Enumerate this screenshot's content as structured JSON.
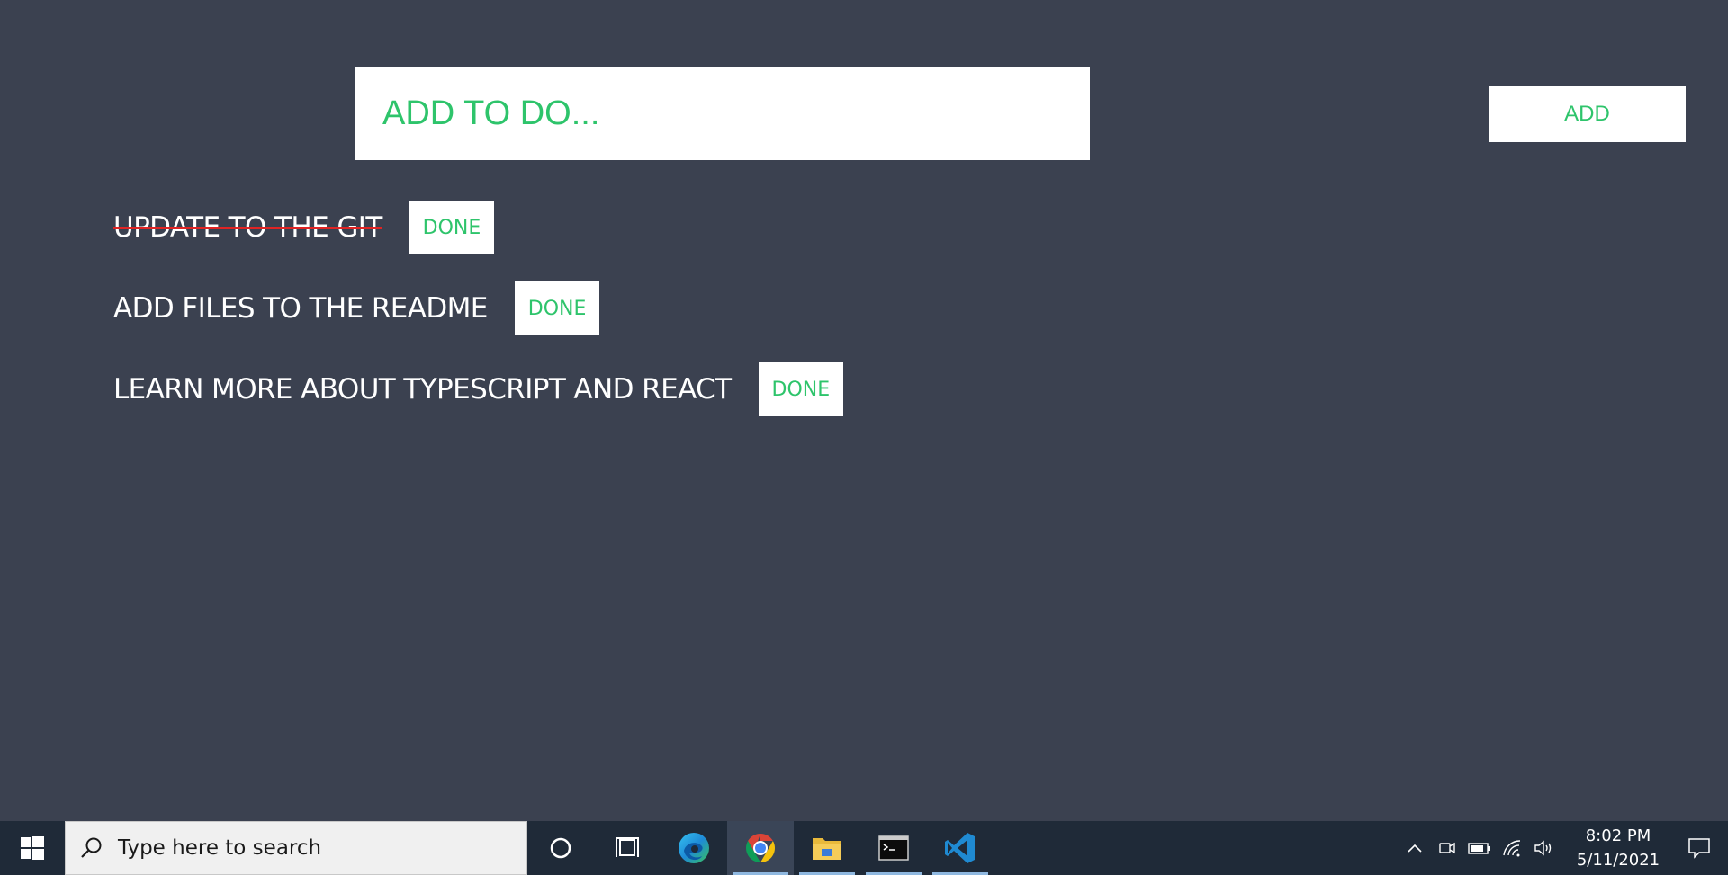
{
  "app": {
    "input": {
      "placeholder": "ADD TO DO...",
      "value": ""
    },
    "add_label": "ADD",
    "todos": [
      {
        "text": "UPDATE TO THE GIT",
        "completed": true,
        "button": "DONE"
      },
      {
        "text": "ADD FILES TO THE README",
        "completed": false,
        "button": "DONE"
      },
      {
        "text": "LEARN MORE ABOUT TYPESCRIPT AND REACT",
        "completed": false,
        "button": "DONE"
      }
    ],
    "colors": {
      "background": "#3b4150",
      "accent": "#2ec46b",
      "strike": "#e02424"
    }
  },
  "taskbar": {
    "search_placeholder": "Type here to search",
    "pinned": [
      {
        "icon": "cortana-icon"
      },
      {
        "icon": "task-view-icon"
      },
      {
        "icon": "edge-icon"
      },
      {
        "icon": "chrome-icon",
        "active": true
      },
      {
        "icon": "file-explorer-icon"
      },
      {
        "icon": "terminal-icon"
      },
      {
        "icon": "vscode-icon"
      }
    ],
    "tray_icons": [
      "chevron-up-icon",
      "meet-now-icon",
      "battery-icon",
      "wifi-icon",
      "volume-icon"
    ],
    "time": "8:02 PM",
    "date": "5/11/2021"
  }
}
